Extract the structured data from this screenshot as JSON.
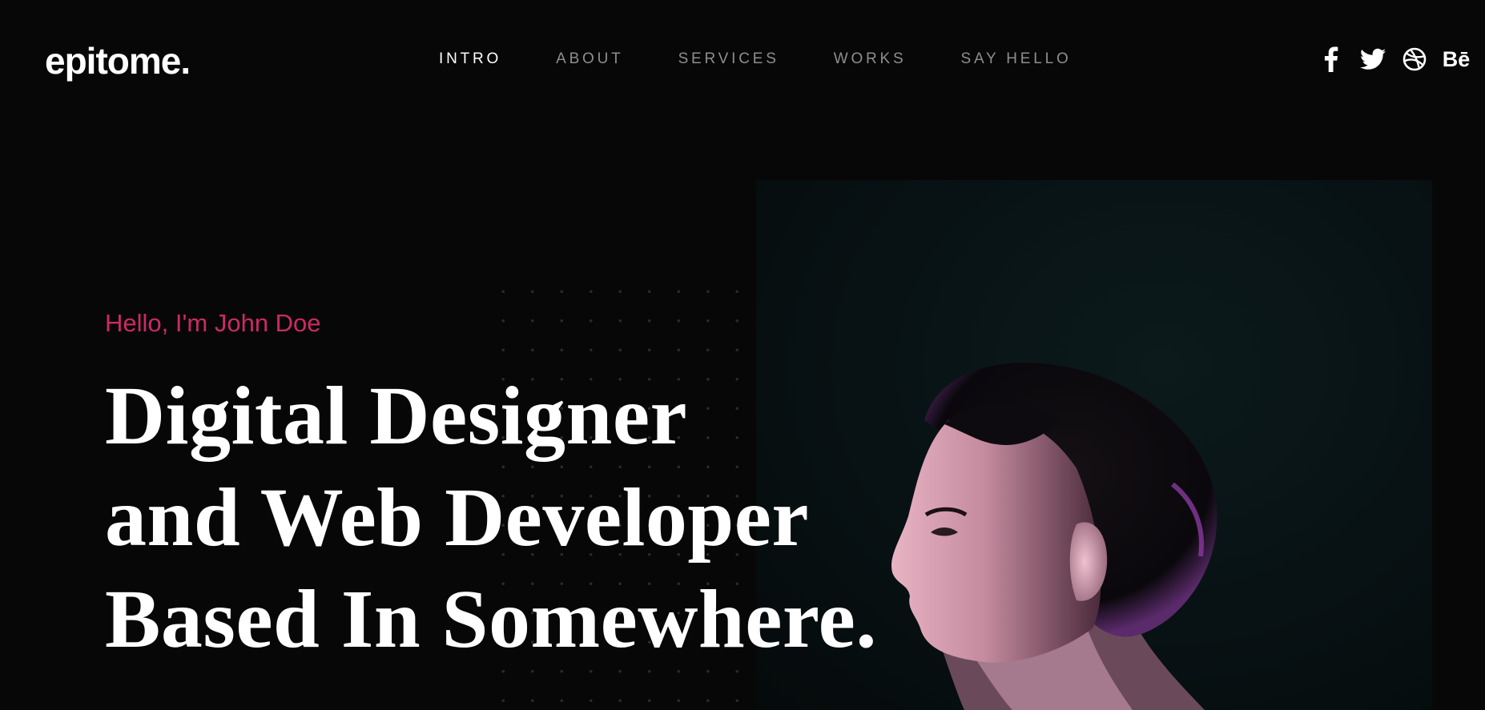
{
  "brand": {
    "logo": "epitome."
  },
  "nav": {
    "items": [
      {
        "label": "INTRO",
        "active": true
      },
      {
        "label": "ABOUT",
        "active": false
      },
      {
        "label": "SERVICES",
        "active": false
      },
      {
        "label": "WORKS",
        "active": false
      },
      {
        "label": "SAY HELLO",
        "active": false
      }
    ]
  },
  "social": {
    "icons": [
      "facebook-icon",
      "twitter-icon",
      "dribbble-icon",
      "behance-icon"
    ],
    "behance_text": "Bē"
  },
  "hero": {
    "greeting": "Hello, I'm John Doe",
    "title_lines": [
      "Digital Designer",
      "and Web Developer",
      "Based In Somewhere."
    ]
  },
  "colors": {
    "background": "#070707",
    "accent": "#cc2a66",
    "nav_active": "#ffffff",
    "nav_inactive": "#8e8e8e",
    "photo_bg": "#081214"
  }
}
